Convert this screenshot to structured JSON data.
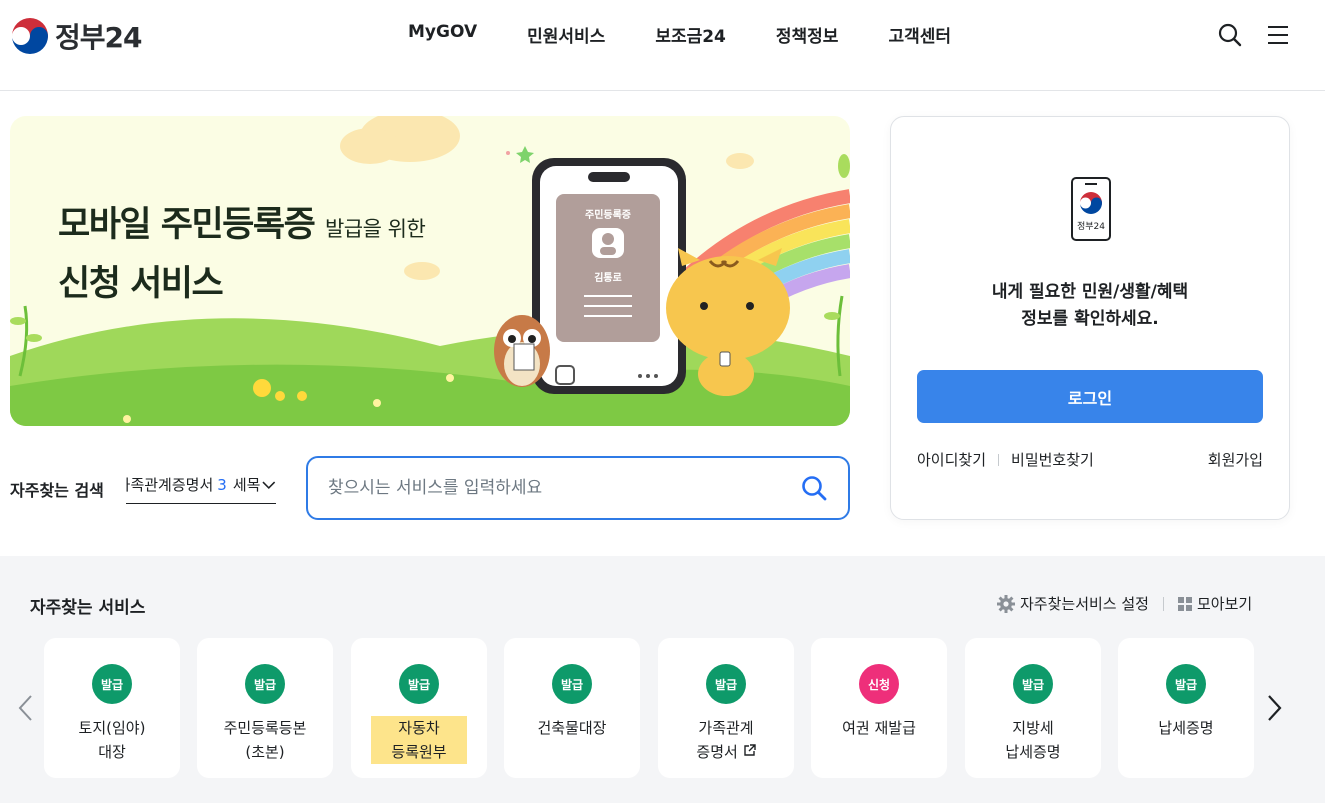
{
  "header": {
    "logo_text": "정부24",
    "nav": [
      "MyGOV",
      "민원서비스",
      "보조금24",
      "정책정보",
      "고객센터"
    ],
    "icons": [
      "search-icon",
      "menu-icon"
    ]
  },
  "banner": {
    "title_line1": "모바일 주민등록증",
    "title_line1_small": "발급을 위한",
    "title_line2": "신청 서비스",
    "card_title": "주민등록증",
    "card_name": "김통로"
  },
  "search": {
    "label": "자주찾는 검색",
    "rolling_keyword": "가족관계증명서",
    "rolling_rank": "3",
    "rolling_keyword2": "세목",
    "placeholder": "찾으시는 서비스를 입력하세요"
  },
  "login": {
    "logo_caption": "정부24",
    "message_line1": "내게 필요한 민원/생활/혜택",
    "message_line2": "정보를 확인하세요.",
    "button": "로그인",
    "find_id": "아이디찾기",
    "find_pw": "비밀번호찾기",
    "signup": "회원가입"
  },
  "services": {
    "title": "자주찾는 서비스",
    "settings": "자주찾는서비스 설정",
    "view_all": "모아보기",
    "items": [
      {
        "badge": "발급",
        "color": "#0e9a6a",
        "line1": "토지(임야)",
        "line2": "대장"
      },
      {
        "badge": "발급",
        "color": "#0e9a6a",
        "line1": "주민등록등본",
        "line2": "(초본)"
      },
      {
        "badge": "발급",
        "color": "#0e9a6a",
        "line1": "자동차",
        "line2": "등록원부"
      },
      {
        "badge": "발급",
        "color": "#0e9a6a",
        "line1": "건축물대장",
        "line2": ""
      },
      {
        "badge": "발급",
        "color": "#0e9a6a",
        "line1": "가족관계",
        "line2": "증명서"
      },
      {
        "badge": "신청",
        "color": "#ee2f7a",
        "line1": "여권 재발급",
        "line2": ""
      },
      {
        "badge": "발급",
        "color": "#0e9a6a",
        "line1": "지방세",
        "line2": "납세증명"
      },
      {
        "badge": "발급",
        "color": "#0e9a6a",
        "line1": "납세증명",
        "line2": ""
      }
    ]
  }
}
